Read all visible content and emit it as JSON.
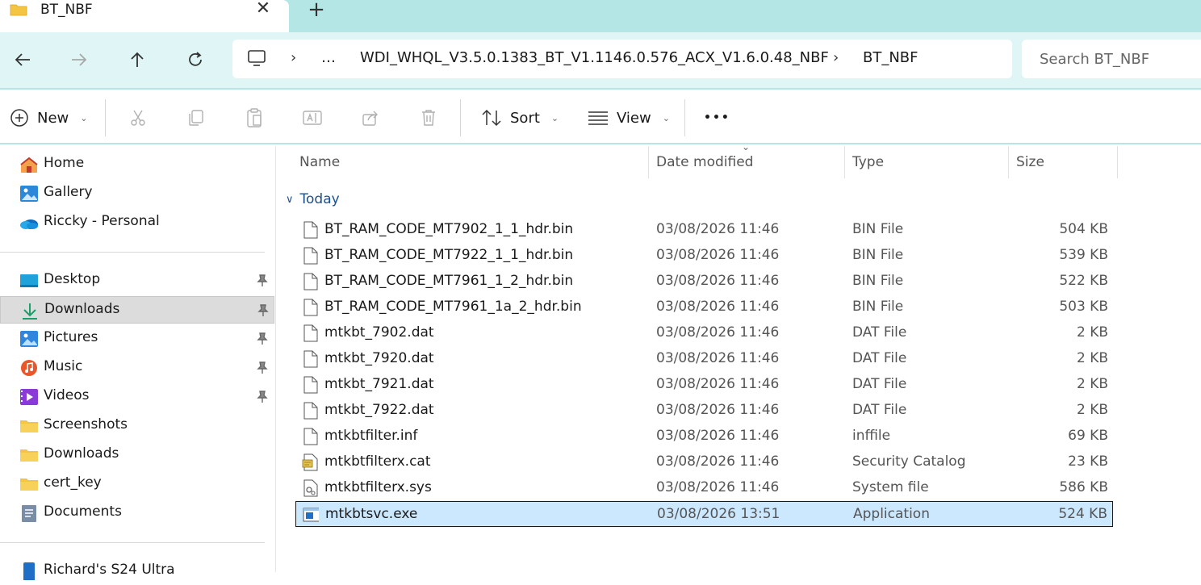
{
  "tab": {
    "title": "BT_NBF",
    "close_glyph": "✕",
    "new_tab_glyph": "+"
  },
  "address": {
    "breadcrumbs": [
      "…",
      "WDI_WHQL_V3.5.0.1383_BT_V1.1146.0.576_ACX_V1.6.0.48_NBF",
      "BT_NBF"
    ],
    "separator": "›"
  },
  "search": {
    "placeholder": "Search BT_NBF"
  },
  "toolbar": {
    "new_label": "New",
    "sort_label": "Sort",
    "view_label": "View",
    "more_glyph": "•••"
  },
  "sidebar": {
    "quick": [
      {
        "label": "Home",
        "icon": "home-icon"
      },
      {
        "label": "Gallery",
        "icon": "gallery-icon"
      },
      {
        "label": "Riccky - Personal",
        "icon": "onedrive-icon"
      }
    ],
    "pinned": [
      {
        "label": "Desktop",
        "icon": "desktop-icon",
        "pinned": true
      },
      {
        "label": "Downloads",
        "icon": "downloads-icon",
        "pinned": true,
        "selected": true
      },
      {
        "label": "Pictures",
        "icon": "pictures-icon",
        "pinned": true
      },
      {
        "label": "Music",
        "icon": "music-icon",
        "pinned": true
      },
      {
        "label": "Videos",
        "icon": "videos-icon",
        "pinned": true
      },
      {
        "label": "Screenshots",
        "icon": "folder-icon"
      },
      {
        "label": "Downloads",
        "icon": "folder-icon"
      },
      {
        "label": "cert_key",
        "icon": "folder-icon"
      },
      {
        "label": "Documents",
        "icon": "documents-icon"
      }
    ],
    "devices": [
      {
        "label": "Richard's S24 Ultra",
        "icon": "phone-icon"
      }
    ]
  },
  "columns": {
    "name": "Name",
    "date": "Date modified",
    "type": "Type",
    "size": "Size"
  },
  "group": {
    "label": "Today"
  },
  "files": [
    {
      "name": "BT_RAM_CODE_MT7902_1_1_hdr.bin",
      "date": "03/08/2026 11:46",
      "type": "BIN File",
      "size": "504 KB",
      "icon": "file-icon"
    },
    {
      "name": "BT_RAM_CODE_MT7922_1_1_hdr.bin",
      "date": "03/08/2026 11:46",
      "type": "BIN File",
      "size": "539 KB",
      "icon": "file-icon"
    },
    {
      "name": "BT_RAM_CODE_MT7961_1_2_hdr.bin",
      "date": "03/08/2026 11:46",
      "type": "BIN File",
      "size": "522 KB",
      "icon": "file-icon"
    },
    {
      "name": "BT_RAM_CODE_MT7961_1a_2_hdr.bin",
      "date": "03/08/2026 11:46",
      "type": "BIN File",
      "size": "503 KB",
      "icon": "file-icon"
    },
    {
      "name": "mtkbt_7902.dat",
      "date": "03/08/2026 11:46",
      "type": "DAT File",
      "size": "2 KB",
      "icon": "file-icon"
    },
    {
      "name": "mtkbt_7920.dat",
      "date": "03/08/2026 11:46",
      "type": "DAT File",
      "size": "2 KB",
      "icon": "file-icon"
    },
    {
      "name": "mtkbt_7921.dat",
      "date": "03/08/2026 11:46",
      "type": "DAT File",
      "size": "2 KB",
      "icon": "file-icon"
    },
    {
      "name": "mtkbt_7922.dat",
      "date": "03/08/2026 11:46",
      "type": "DAT File",
      "size": "2 KB",
      "icon": "file-icon"
    },
    {
      "name": "mtkbtfilter.inf",
      "date": "03/08/2026 11:46",
      "type": "inffile",
      "size": "69 KB",
      "icon": "file-icon"
    },
    {
      "name": "mtkbtfilterx.cat",
      "date": "03/08/2026 11:46",
      "type": "Security Catalog",
      "size": "23 KB",
      "icon": "catalog-icon"
    },
    {
      "name": "mtkbtfilterx.sys",
      "date": "03/08/2026 11:46",
      "type": "System file",
      "size": "586 KB",
      "icon": "system-file-icon"
    },
    {
      "name": "mtkbtsvc.exe",
      "date": "03/08/2026 13:51",
      "type": "Application",
      "size": "524 KB",
      "icon": "application-icon",
      "selected": true
    }
  ],
  "colors": {
    "accent": "#b4e6e6",
    "selection": "#cce8ff",
    "sidebar_selected": "#dcdcdc"
  }
}
